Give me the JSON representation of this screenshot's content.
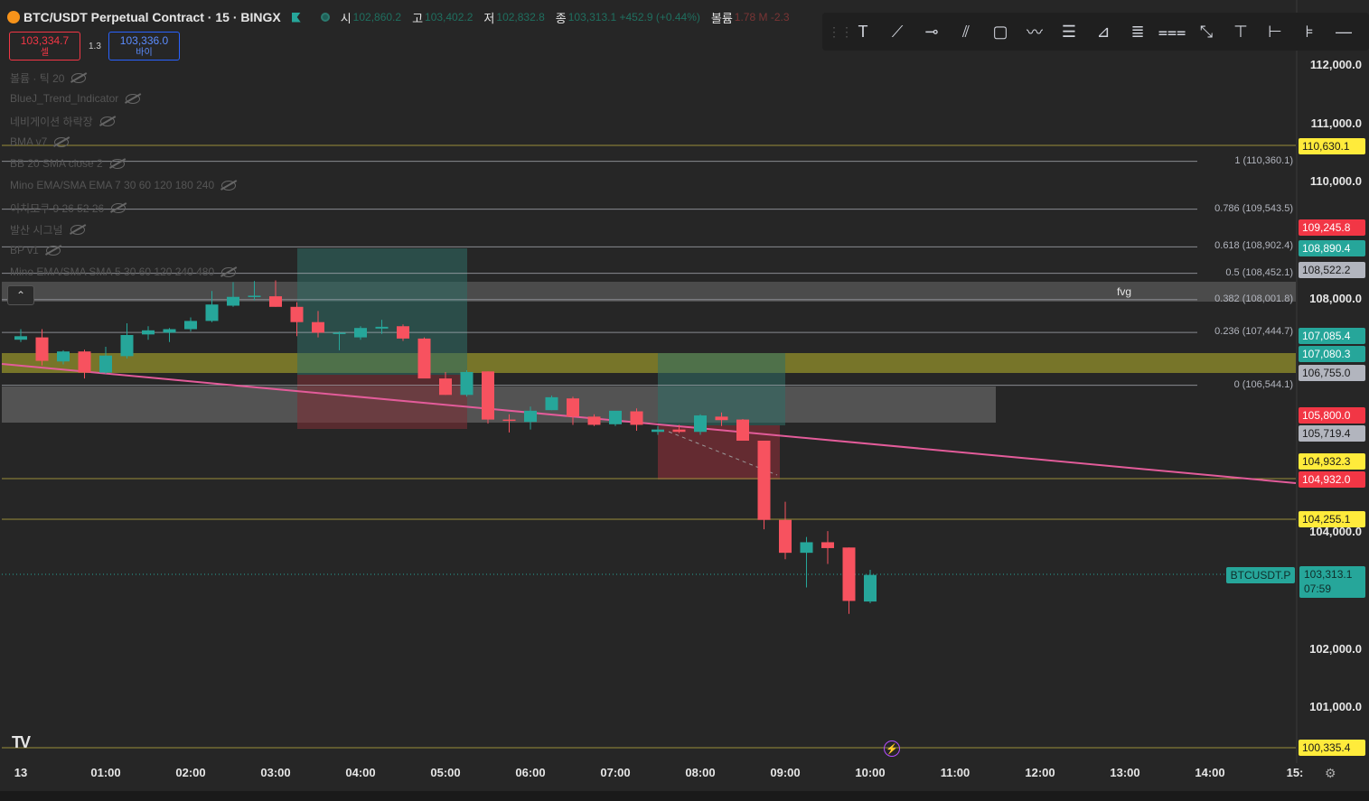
{
  "header": {
    "title": "BTC/USDT Perpetual Contract · 15 · BINGX",
    "ohlc": [
      {
        "label": "시",
        "value": "102,860.2"
      },
      {
        "label": "고",
        "value": "103,402.2"
      },
      {
        "label": "저",
        "value": "102,832.8"
      },
      {
        "label": "종",
        "value": "103,313.1 +452.9 (+0.44%)"
      },
      {
        "label": "볼륨",
        "value": "1.78 M  -2.3"
      }
    ]
  },
  "trade": {
    "sell_price": "103,334.7",
    "sell_label": "셀",
    "buy_price": "103,336.0",
    "buy_label": "바이",
    "spread": "1.3"
  },
  "indicators": [
    "볼륨 · 틱 20",
    "BlueJ_Trend_Indicator",
    "네비게이션 하락장",
    "BMA v7",
    "BB 20 SMA close 2",
    "Mino EMA/SMA EMA 7 30 60 120 180 240",
    "이치모쿠 9 26 52 26",
    "발산 시그널",
    "BP v1",
    "Mino EMA/SMA SMA 5 30 60 120 240 480"
  ],
  "toolbar": [
    "text-tool",
    "trend-line-tool",
    "horizontal-ray-tool",
    "parallel-channel-tool",
    "rectangle-tool",
    "path-tool",
    "long-position-tool",
    "fib-fan-tool",
    "fib-retracement-tool",
    "regression-tool",
    "measure-tool",
    "price-note-tool",
    "date-range-tool",
    "long-short-tool",
    "horizontal-line-tool"
  ],
  "price_axis": {
    "ticks": [
      "112,000.0",
      "111,000.0",
      "110,000.0",
      "108,000.0",
      "104,000.0",
      "102,000.0",
      "101,000.0"
    ],
    "labels": [
      {
        "text": "110,630.1",
        "kind": "yellow"
      },
      {
        "text": "109,245.8",
        "kind": "red"
      },
      {
        "text": "108,890.4",
        "kind": "green"
      },
      {
        "text": "108,522.2",
        "kind": "gray"
      },
      {
        "text": "107,085.4",
        "kind": "green"
      },
      {
        "text": "107,080.3",
        "kind": "green"
      },
      {
        "text": "106,755.0",
        "kind": "gray"
      },
      {
        "text": "105,800.0",
        "kind": "red"
      },
      {
        "text": "105,719.4",
        "kind": "gray"
      },
      {
        "text": "104,932.3",
        "kind": "yellow"
      },
      {
        "text": "104,932.0",
        "kind": "red"
      },
      {
        "text": "104,255.1",
        "kind": "yellow"
      },
      {
        "text": "100,335.4",
        "kind": "yellow"
      }
    ],
    "current_symbol": "BTCUSDT.P",
    "current_price": "103,313.1",
    "countdown": "07:59"
  },
  "fib_levels": [
    {
      "label": "1 (110,360.1)",
      "price": 110360.1
    },
    {
      "label": "0.786 (109,543.5)",
      "price": 109543.5
    },
    {
      "label": "0.618 (108,902.4)",
      "price": 108902.4
    },
    {
      "label": "0.5 (108,452.1)",
      "price": 108452.1
    },
    {
      "label": "0.382 (108,001.8)",
      "price": 108001.8
    },
    {
      "label": "0.236 (107,444.7)",
      "price": 107444.7
    },
    {
      "label": "0 (106,544.1)",
      "price": 106544.1
    }
  ],
  "fvg_label": "fvg",
  "time_axis": [
    "13",
    "01:00",
    "02:00",
    "03:00",
    "04:00",
    "05:00",
    "06:00",
    "07:00",
    "08:00",
    "09:00",
    "10:00",
    "11:00",
    "12:00",
    "13:00",
    "14:00",
    "15:"
  ],
  "colors": {
    "up": "#26a69a",
    "down": "#f7525f",
    "yellow": "#ffeb3b",
    "red": "#f23645",
    "green": "#26a69a",
    "gray": "#b2b5be"
  },
  "chart_data": {
    "type": "candlestick",
    "candles": [
      {
        "o": 107320,
        "h": 107500,
        "l": 107280,
        "c": 107380
      },
      {
        "o": 107360,
        "h": 107500,
        "l": 106880,
        "c": 106960
      },
      {
        "o": 106950,
        "h": 107140,
        "l": 106900,
        "c": 107120
      },
      {
        "o": 107120,
        "h": 107150,
        "l": 106660,
        "c": 106760
      },
      {
        "o": 106760,
        "h": 107200,
        "l": 106740,
        "c": 107050
      },
      {
        "o": 107040,
        "h": 107600,
        "l": 107000,
        "c": 107400
      },
      {
        "o": 107410,
        "h": 107550,
        "l": 107320,
        "c": 107480
      },
      {
        "o": 107440,
        "h": 107520,
        "l": 107280,
        "c": 107500
      },
      {
        "o": 107500,
        "h": 107700,
        "l": 107460,
        "c": 107640
      },
      {
        "o": 107640,
        "h": 108150,
        "l": 107620,
        "c": 107920
      },
      {
        "o": 107900,
        "h": 108300,
        "l": 107880,
        "c": 108050
      },
      {
        "o": 108050,
        "h": 108320,
        "l": 107990,
        "c": 108070
      },
      {
        "o": 108060,
        "h": 108330,
        "l": 107880,
        "c": 107880
      },
      {
        "o": 107880,
        "h": 107960,
        "l": 107380,
        "c": 107620
      },
      {
        "o": 107620,
        "h": 107810,
        "l": 107360,
        "c": 107440
      },
      {
        "o": 107440,
        "h": 107460,
        "l": 107140,
        "c": 107440
      },
      {
        "o": 107360,
        "h": 107550,
        "l": 107320,
        "c": 107520
      },
      {
        "o": 107510,
        "h": 107660,
        "l": 107420,
        "c": 107540
      },
      {
        "o": 107550,
        "h": 107580,
        "l": 107300,
        "c": 107340
      },
      {
        "o": 107340,
        "h": 107360,
        "l": 106670,
        "c": 106660
      },
      {
        "o": 106660,
        "h": 106770,
        "l": 106380,
        "c": 106380
      },
      {
        "o": 106380,
        "h": 106800,
        "l": 106350,
        "c": 106770
      },
      {
        "o": 106780,
        "h": 106780,
        "l": 105890,
        "c": 105960
      },
      {
        "o": 105960,
        "h": 106050,
        "l": 105740,
        "c": 105940
      },
      {
        "o": 105920,
        "h": 106180,
        "l": 105790,
        "c": 106110
      },
      {
        "o": 106120,
        "h": 106370,
        "l": 106120,
        "c": 106340
      },
      {
        "o": 106320,
        "h": 106350,
        "l": 105870,
        "c": 106010
      },
      {
        "o": 106010,
        "h": 106050,
        "l": 105850,
        "c": 105870
      },
      {
        "o": 105880,
        "h": 106010,
        "l": 105850,
        "c": 106110
      },
      {
        "o": 106100,
        "h": 106150,
        "l": 105770,
        "c": 105870
      },
      {
        "o": 105750,
        "h": 105850,
        "l": 105700,
        "c": 105790
      },
      {
        "o": 105790,
        "h": 105870,
        "l": 105730,
        "c": 105750
      },
      {
        "o": 105750,
        "h": 106050,
        "l": 105700,
        "c": 106030
      },
      {
        "o": 106010,
        "h": 106080,
        "l": 105850,
        "c": 105950
      },
      {
        "o": 105960,
        "h": 105970,
        "l": 105600,
        "c": 105600
      },
      {
        "o": 105600,
        "h": 105600,
        "l": 104090,
        "c": 104250
      },
      {
        "o": 104250,
        "h": 104560,
        "l": 103580,
        "c": 103690
      },
      {
        "o": 103690,
        "h": 103960,
        "l": 103100,
        "c": 103870
      },
      {
        "o": 103870,
        "h": 104060,
        "l": 103500,
        "c": 103770
      },
      {
        "o": 103780,
        "h": 103780,
        "l": 102650,
        "c": 102870
      },
      {
        "o": 102860,
        "h": 103400,
        "l": 102830,
        "c": 103313
      }
    ]
  }
}
